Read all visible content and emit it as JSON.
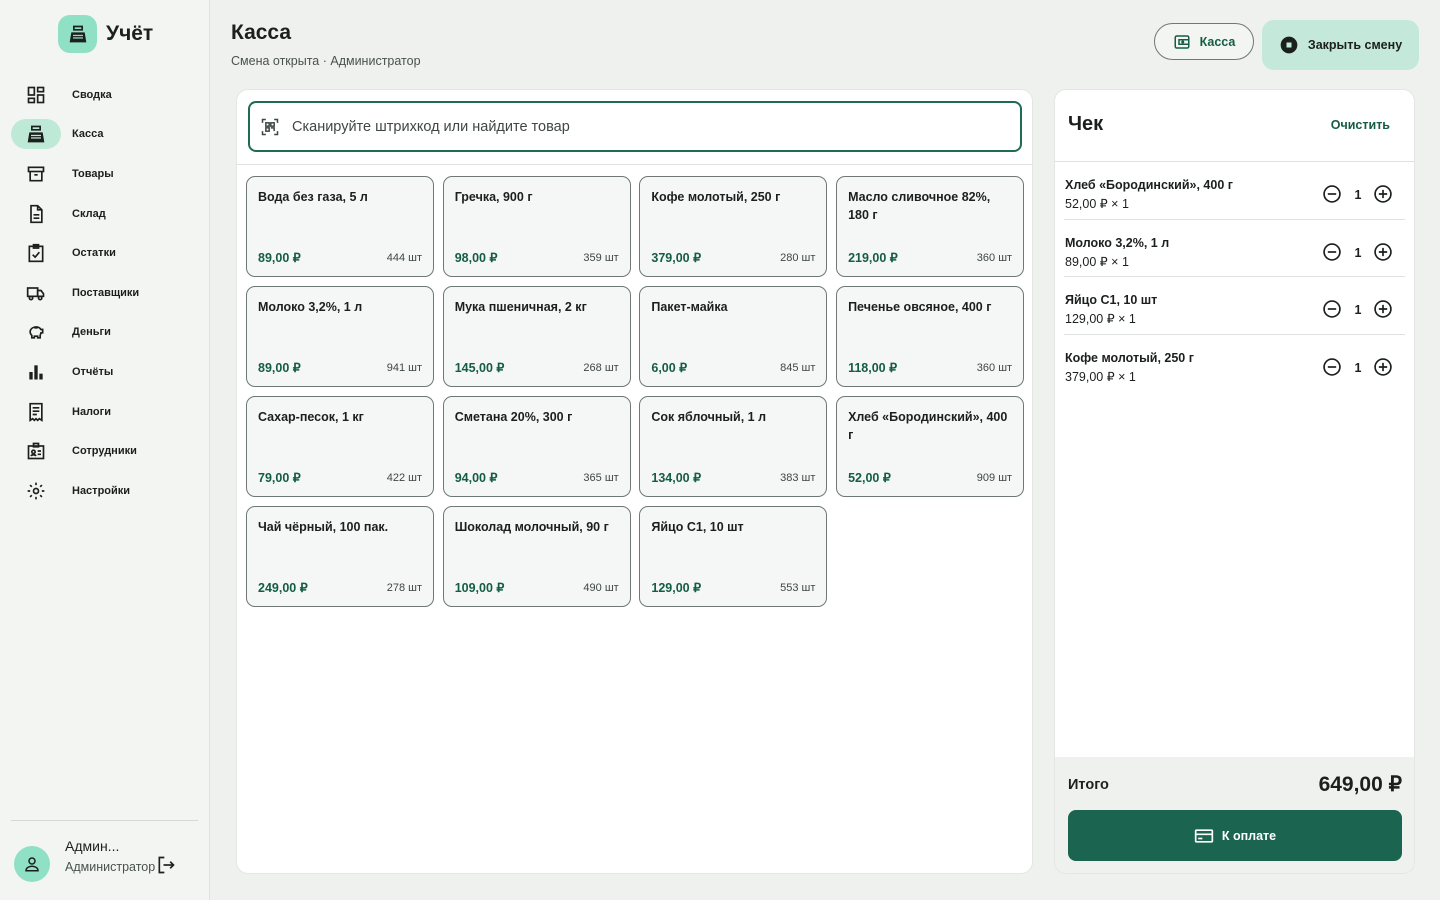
{
  "app": {
    "name": "Учёт",
    "logo_icon": "cash-register-icon"
  },
  "sidebar": {
    "items": [
      {
        "label": "Сводка",
        "icon": "dashboard-icon",
        "active": false
      },
      {
        "label": "Касса",
        "icon": "cash-register-icon",
        "active": true
      },
      {
        "label": "Товары",
        "icon": "archive-box-icon",
        "active": false
      },
      {
        "label": "Склад",
        "icon": "document-icon",
        "active": false
      },
      {
        "label": "Остатки",
        "icon": "clipboard-check-icon",
        "active": false
      },
      {
        "label": "Поставщики",
        "icon": "truck-icon",
        "active": false
      },
      {
        "label": "Деньги",
        "icon": "piggy-bank-icon",
        "active": false
      },
      {
        "label": "Отчёты",
        "icon": "bar-chart-icon",
        "active": false
      },
      {
        "label": "Налоги",
        "icon": "receipt-icon",
        "active": false
      },
      {
        "label": "Сотрудники",
        "icon": "id-badge-icon",
        "active": false
      },
      {
        "label": "Настройки",
        "icon": "gear-icon",
        "active": false
      }
    ],
    "user": {
      "name": "Админ...",
      "role": "Администратор"
    }
  },
  "header": {
    "title": "Касса",
    "subtitle": "Смена открыта · Администратор",
    "kassa_button": "Касса",
    "close_shift_button": "Закрыть смену"
  },
  "search": {
    "placeholder": "Сканируйте штрихкод или найдите товар"
  },
  "products": [
    {
      "name": "Вода без газа, 5 л",
      "price": "89,00 ₽",
      "stock": "444 шт"
    },
    {
      "name": "Гречка, 900 г",
      "price": "98,00 ₽",
      "stock": "359 шт"
    },
    {
      "name": "Кофе молотый, 250 г",
      "price": "379,00 ₽",
      "stock": "280 шт"
    },
    {
      "name": "Масло сливочное 82%, 180 г",
      "price": "219,00 ₽",
      "stock": "360 шт"
    },
    {
      "name": "Молоко 3,2%, 1 л",
      "price": "89,00 ₽",
      "stock": "941 шт"
    },
    {
      "name": "Мука пшеничная, 2 кг",
      "price": "145,00 ₽",
      "stock": "268 шт"
    },
    {
      "name": "Пакет-майка",
      "price": "6,00 ₽",
      "stock": "845 шт"
    },
    {
      "name": "Печенье овсяное, 400 г",
      "price": "118,00 ₽",
      "stock": "360 шт"
    },
    {
      "name": "Сахар-песок, 1 кг",
      "price": "79,00 ₽",
      "stock": "422 шт"
    },
    {
      "name": "Сметана 20%, 300 г",
      "price": "94,00 ₽",
      "stock": "365 шт"
    },
    {
      "name": "Сок яблочный, 1 л",
      "price": "134,00 ₽",
      "stock": "383 шт"
    },
    {
      "name": "Хлеб «Бородинский», 400 г",
      "price": "52,00 ₽",
      "stock": "909 шт"
    },
    {
      "name": "Чай чёрный, 100 пак.",
      "price": "249,00 ₽",
      "stock": "278 шт"
    },
    {
      "name": "Шоколад молочный, 90 г",
      "price": "109,00 ₽",
      "stock": "490 шт"
    },
    {
      "name": "Яйцо С1, 10 шт",
      "price": "129,00 ₽",
      "stock": "553 шт"
    }
  ],
  "receipt": {
    "title": "Чек",
    "clear_label": "Очистить",
    "lines": [
      {
        "name": "Хлеб «Бородинский», 400 г",
        "price": "52,00 ₽ × 1",
        "count": "1"
      },
      {
        "name": "Молоко 3,2%, 1 л",
        "price": "89,00 ₽ × 1",
        "count": "1"
      },
      {
        "name": "Яйцо С1, 10 шт",
        "price": "129,00 ₽ × 1",
        "count": "1"
      },
      {
        "name": "Кофе молотый, 250 г",
        "price": "379,00 ₽ × 1",
        "count": "1"
      }
    ],
    "total_label": "Итого",
    "total_value": "649,00 ₽",
    "pay_button": "К оплате"
  },
  "colors": {
    "accent": "#1a6450",
    "accent_light": "#8fe0c4",
    "active_nav": "#bfe9d7",
    "price": "#155c47"
  }
}
